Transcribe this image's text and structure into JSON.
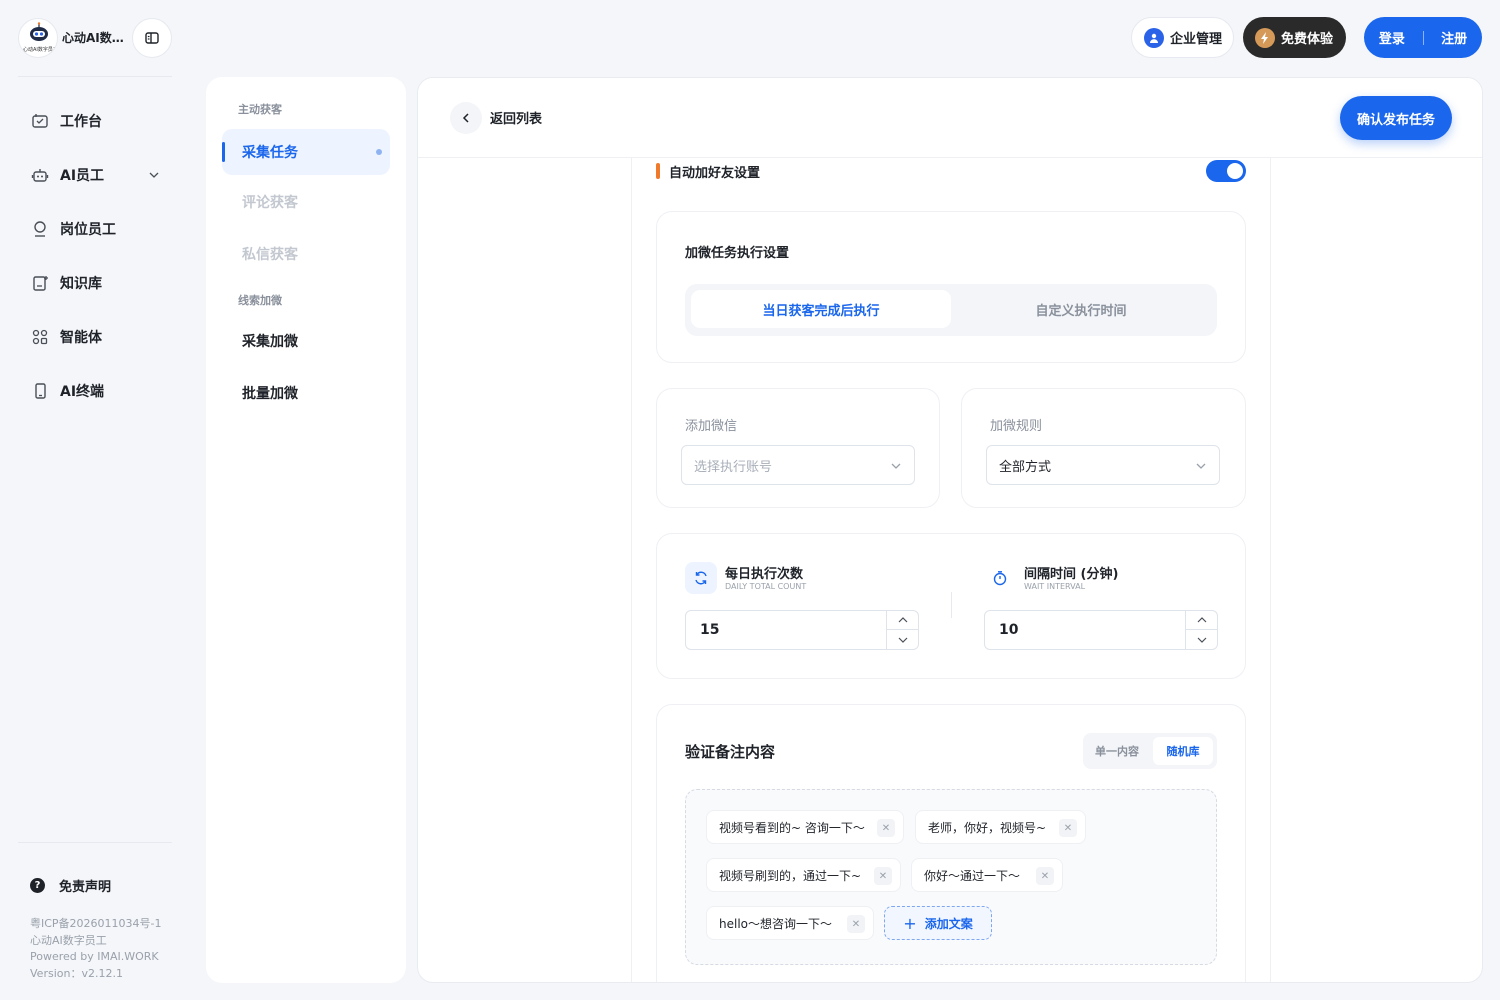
{
  "brand": {
    "name": "心动AI数字员工",
    "logo_caption": "心动AI数字员工"
  },
  "sidebar": {
    "items": [
      {
        "label": "工作台",
        "icon": "workbench-icon"
      },
      {
        "label": "AI员工",
        "icon": "robot-icon",
        "expandable": true
      },
      {
        "label": "岗位员工",
        "icon": "user-icon"
      },
      {
        "label": "知识库",
        "icon": "knowledge-icon"
      },
      {
        "label": "智能体",
        "icon": "agent-grid-icon"
      },
      {
        "label": "AI终端",
        "icon": "phone-icon"
      }
    ],
    "disclaimer": "免责声明",
    "footer": {
      "icp": "粤ICP备2026011034号-1",
      "company": "心动AI数字员工",
      "powered": "Powered by IMAI.WORK",
      "version": "Version：v2.12.1"
    }
  },
  "header": {
    "enterprise": "企业管理",
    "trial": "免费体验",
    "login": "登录",
    "register": "注册"
  },
  "subnav": {
    "group1": "主动获客",
    "items1": [
      "采集任务",
      "评论获客",
      "私信获客"
    ],
    "group2": "线索加微",
    "items2": [
      "采集加微",
      "批量加微"
    ]
  },
  "page": {
    "back": "返回列表",
    "publish": "确认发布任务",
    "section_title": "自动加好友设置",
    "toggle_on": true,
    "exec": {
      "title": "加微任务执行设置",
      "option_selected": "当日获客完成后执行",
      "option_other": "自定义执行时间"
    },
    "wechat": {
      "label": "添加微信",
      "placeholder": "选择执行账号"
    },
    "rule": {
      "label": "加微规则",
      "value": "全部方式"
    },
    "daily": {
      "title": "每日执行次数",
      "subtitle": "DAILY TOTAL COUNT",
      "value": "15"
    },
    "interval": {
      "title": "间隔时间 (分钟)",
      "subtitle": "WAIT INTERVAL",
      "value": "10"
    },
    "remark": {
      "title": "验证备注内容",
      "mode_single": "单一内容",
      "mode_random": "随机库",
      "tags": [
        "视频号看到的~ 咨询一下～",
        "老师，你好，视频号~",
        "视频号刷到的，通过一下~",
        "你好～通过一下～",
        "hello～想咨询一下～"
      ],
      "add": "添加文案"
    }
  },
  "colors": {
    "accent": "#1a66ec",
    "section_mark": "#f07a2b",
    "dark_button": "#2a2a2a"
  }
}
